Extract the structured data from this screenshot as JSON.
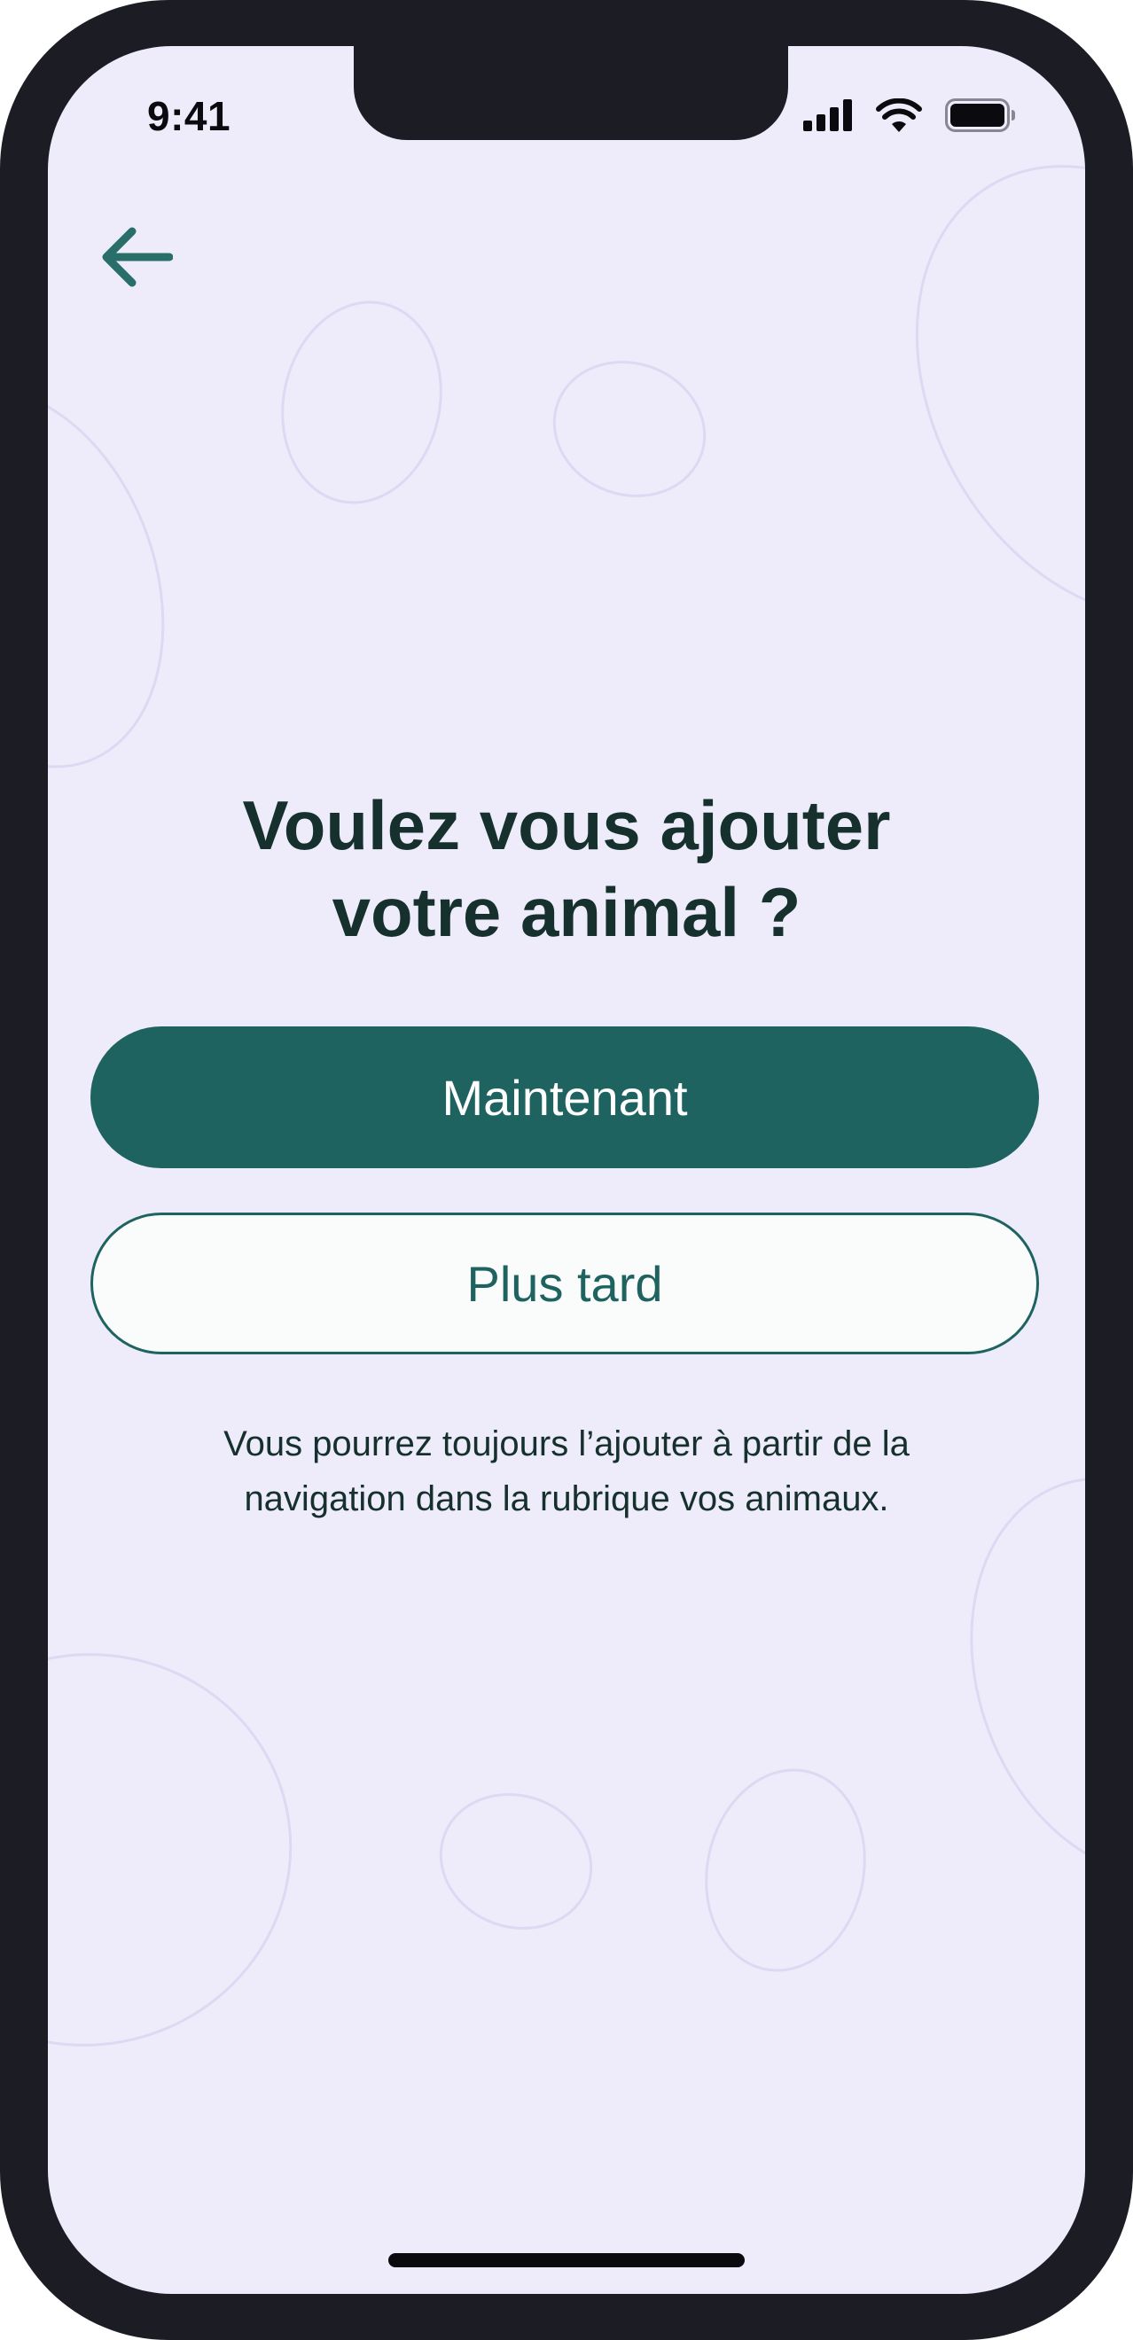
{
  "status_bar": {
    "time": "9:41",
    "icons": [
      "cellular-signal-icon",
      "wifi-icon",
      "battery-icon"
    ]
  },
  "navigation": {
    "back_icon": "arrow-left-icon"
  },
  "main": {
    "title_line1": "Voulez vous ajouter",
    "title_line2": "votre animal ?",
    "primary_button_label": "Maintenant",
    "secondary_button_label": "Plus tard",
    "hint_line1": "Vous pourrez toujours l’ajouter à partir de la",
    "hint_line2": "navigation dans la rubrique vos animaux."
  },
  "colors": {
    "background": "#eeecfa",
    "accent": "#1f6360",
    "title_text": "#16302d",
    "decorative_outline": "#ddd9f3"
  }
}
